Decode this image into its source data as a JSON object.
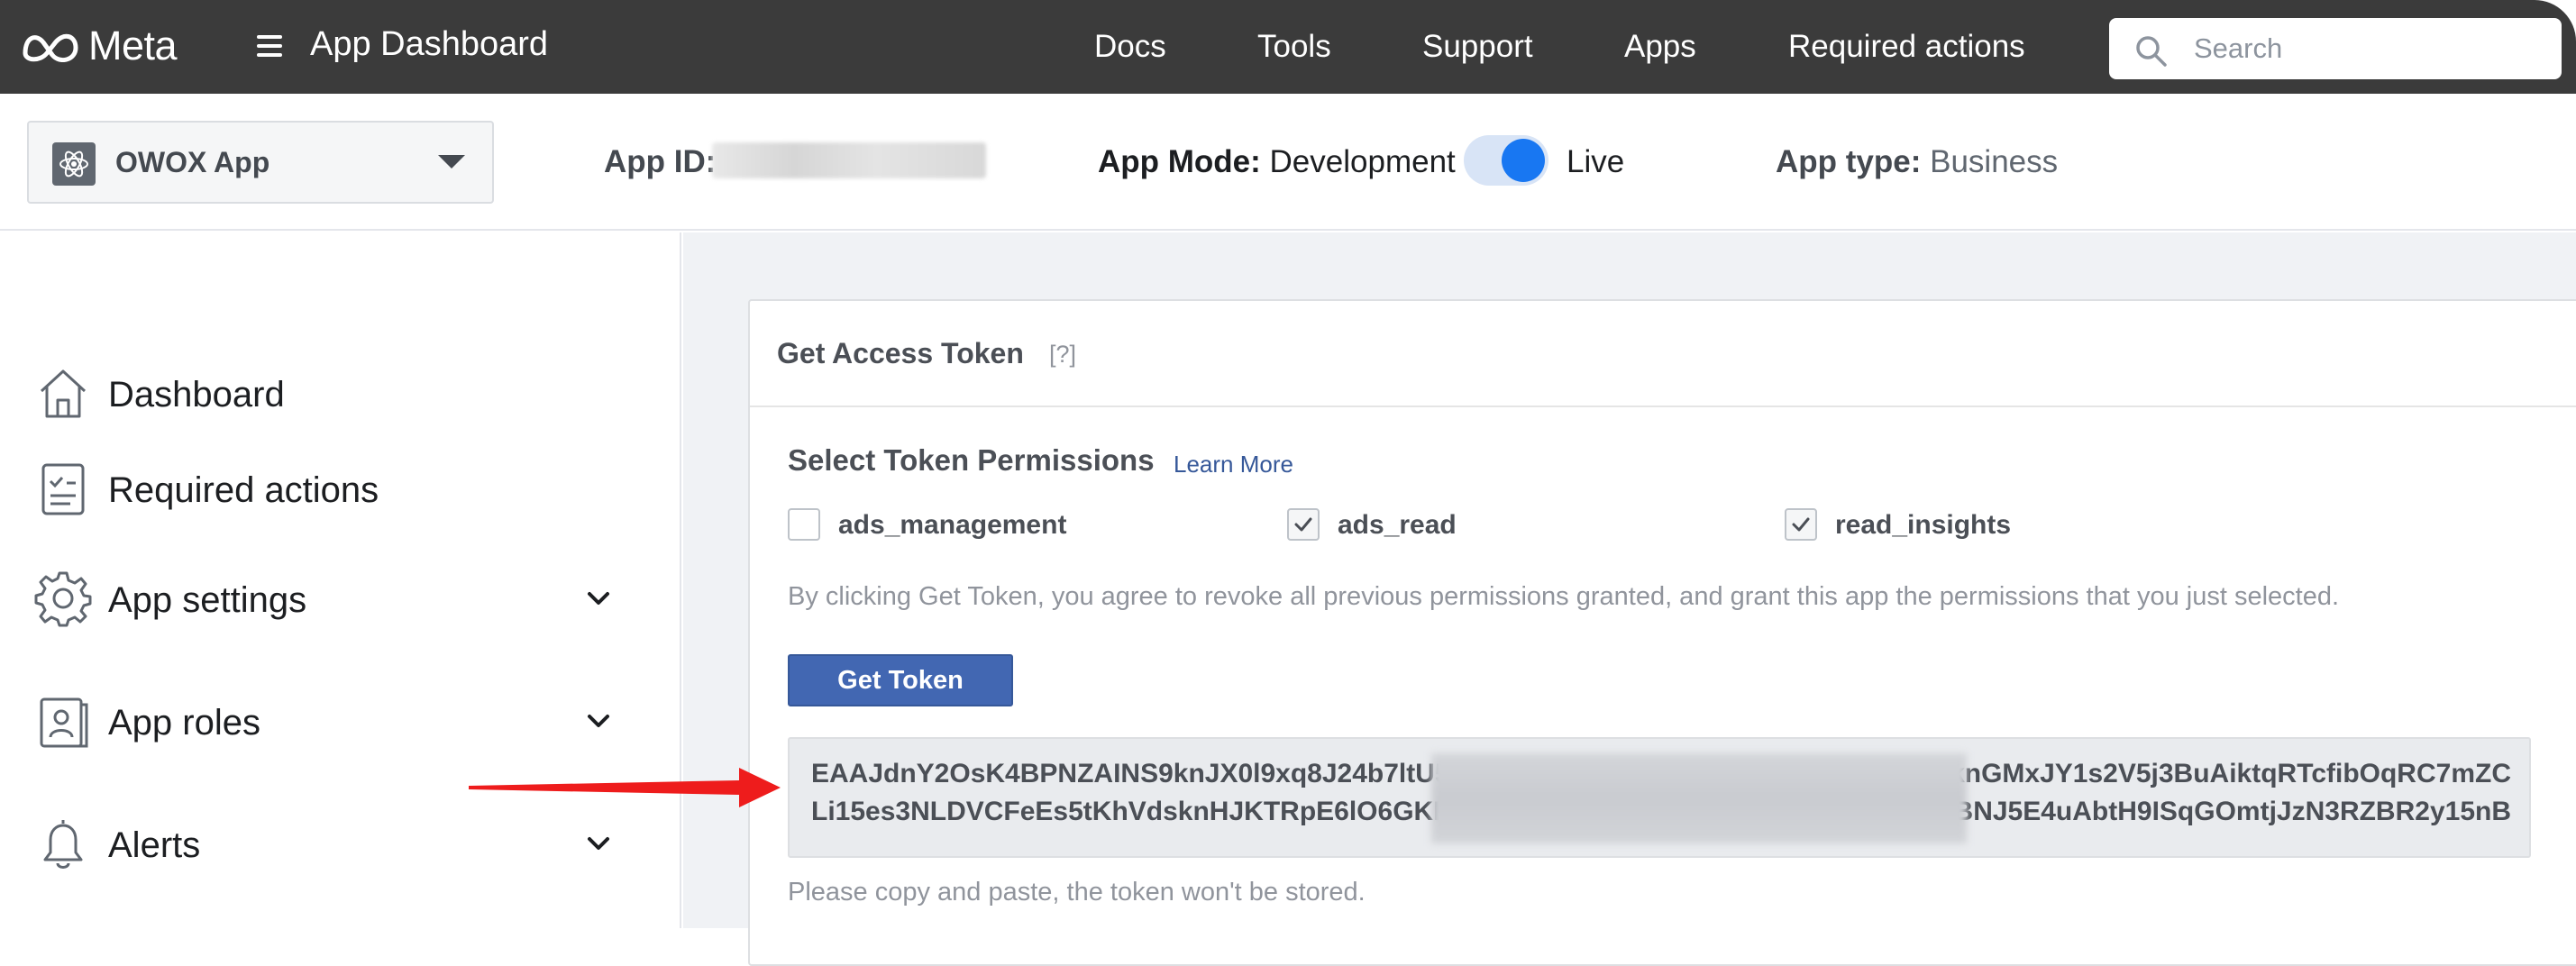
{
  "topbar": {
    "brand": "Meta",
    "title": "App Dashboard",
    "nav": [
      "Docs",
      "Tools",
      "Support",
      "Apps",
      "Required actions"
    ],
    "search_placeholder": "Search"
  },
  "appbar": {
    "app_name": "OWOX App",
    "app_id_label": "App ID:",
    "app_mode_label": "App Mode:",
    "app_mode_value": "Development",
    "live_label": "Live",
    "app_type_label": "App type:",
    "app_type_value": "Business"
  },
  "sidebar": {
    "items": [
      {
        "label": "Dashboard",
        "icon": "home-icon"
      },
      {
        "label": "Required actions",
        "icon": "clipboard-check-icon"
      },
      {
        "label": "App settings",
        "icon": "gear-icon"
      },
      {
        "label": "App roles",
        "icon": "id-badge-icon"
      },
      {
        "label": "Alerts",
        "icon": "bell-icon"
      }
    ]
  },
  "card": {
    "title": "Get Access Token",
    "help": "[?]",
    "permissions_title": "Select Token Permissions",
    "learn_more": "Learn More",
    "permissions": [
      {
        "label": "ads_management",
        "checked": false
      },
      {
        "label": "ads_read",
        "checked": true
      },
      {
        "label": "read_insights",
        "checked": true
      }
    ],
    "disclaimer": "By clicking Get Token, you agree to revoke all previous permissions granted, and grant this app the permissions that you just selected.",
    "button": "Get Token",
    "token_line1_start": "EAAJdnY2OsK4BPNZAINS9knJX0l9xq8J24b7ltU5",
    "token_line1_end": "knGMxJY1s2V5j3BuAiktqRTcfibOqRC7mZC",
    "token_line2_start": "Li15es3NLDVCFeEs5tKhVdsknHJKTRpE6lO6GKKt",
    "token_line2_end": "iBNJ5E4uAbtH9ISqGOmtjJzN3RZBR2y15nB",
    "note": "Please copy and paste, the token won't be stored."
  },
  "colors": {
    "topbar": "#3b3b3b",
    "button": "#4267b2",
    "toggle_on": "#1877f2",
    "link": "#365899",
    "arrow": "#ee1c1c"
  }
}
